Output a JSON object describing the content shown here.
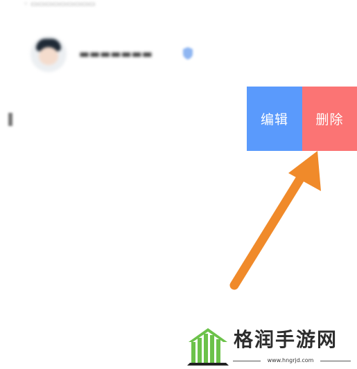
{
  "actions": {
    "edit_label": "编辑",
    "delete_label": "删除",
    "edit_color": "#5a9afc",
    "delete_color": "#fb7474"
  },
  "annotation": {
    "arrow_color": "#f08a2a",
    "arrow_icon": "arrow-up-right-icon"
  },
  "watermark": {
    "brand_text": "格润手游网",
    "url": "www.hngrjd.com",
    "logo_icon": "green-house-logo-icon",
    "logo_color": "#6cc24a"
  },
  "colors": {
    "background": "#ffffff"
  }
}
